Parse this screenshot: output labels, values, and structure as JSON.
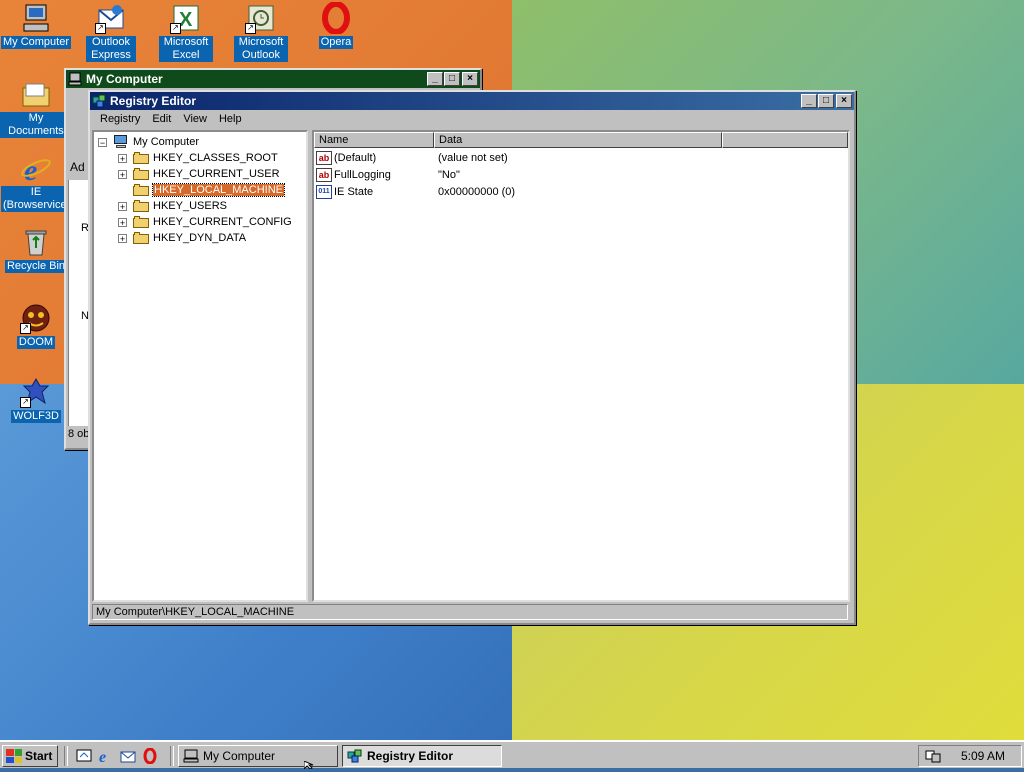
{
  "desktop": {
    "icons": [
      {
        "label": "My Computer"
      },
      {
        "label": "Outlook Express"
      },
      {
        "label": "Microsoft Excel"
      },
      {
        "label": "Microsoft Outlook"
      },
      {
        "label": "Opera"
      },
      {
        "label": "My Documents"
      },
      {
        "label": "IE (Browservice)"
      },
      {
        "label": "Recycle Bin"
      },
      {
        "label": "DOOM"
      },
      {
        "label": "WOLF3D"
      }
    ]
  },
  "mycomputer_window": {
    "title": "My Computer",
    "partial_texts": [
      "Ad",
      "R",
      "N",
      "8 ob"
    ]
  },
  "regedit": {
    "title": "Registry Editor",
    "menu": [
      "Registry",
      "Edit",
      "View",
      "Help"
    ],
    "tree": {
      "root": "My Computer",
      "keys": [
        "HKEY_CLASSES_ROOT",
        "HKEY_CURRENT_USER",
        "HKEY_LOCAL_MACHINE",
        "HKEY_USERS",
        "HKEY_CURRENT_CONFIG",
        "HKEY_DYN_DATA"
      ],
      "selected": "HKEY_LOCAL_MACHINE"
    },
    "columns": [
      "Name",
      "Data"
    ],
    "values": [
      {
        "name": "(Default)",
        "data": "(value not set)",
        "type_icon": "ab"
      },
      {
        "name": "FullLogging",
        "data": "\"No\"",
        "type_icon": "ab"
      },
      {
        "name": "IE State",
        "data": "0x00000000 (0)",
        "type_icon": "011"
      }
    ],
    "status": "My Computer\\HKEY_LOCAL_MACHINE"
  },
  "taskbar": {
    "start_label": "Start",
    "tasks": [
      {
        "label": "My Computer",
        "active": false
      },
      {
        "label": "Registry Editor",
        "active": true
      }
    ],
    "clock": "5:09 AM"
  },
  "colors": {
    "title_active": "#0a246a",
    "selection": "#d56a2a",
    "face": "#c0c0c0"
  }
}
